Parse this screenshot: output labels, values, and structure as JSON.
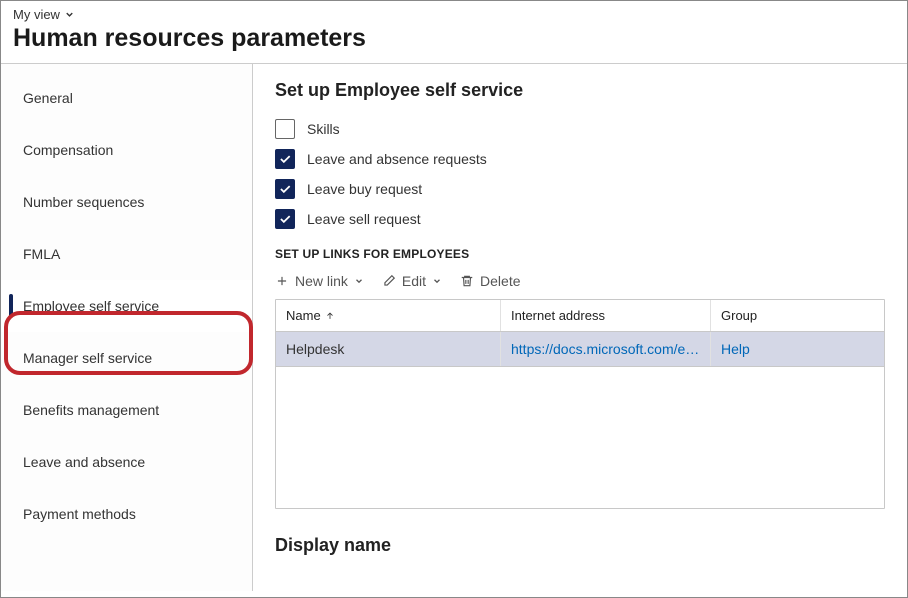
{
  "viewSelector": {
    "label": "My view"
  },
  "pageTitle": "Human resources parameters",
  "sidebar": {
    "items": [
      {
        "label": "General",
        "active": false
      },
      {
        "label": "Compensation",
        "active": false
      },
      {
        "label": "Number sequences",
        "active": false
      },
      {
        "label": "FMLA",
        "active": false
      },
      {
        "label": "Employee self service",
        "active": true
      },
      {
        "label": "Manager self service",
        "active": false
      },
      {
        "label": "Benefits management",
        "active": false
      },
      {
        "label": "Leave and absence",
        "active": false
      },
      {
        "label": "Payment methods",
        "active": false
      }
    ]
  },
  "content": {
    "sectionTitle": "Set up Employee self service",
    "checkboxes": [
      {
        "label": "Skills",
        "checked": false
      },
      {
        "label": "Leave and absence requests",
        "checked": true
      },
      {
        "label": "Leave buy request",
        "checked": true
      },
      {
        "label": "Leave sell request",
        "checked": true
      }
    ],
    "linksCaption": "SET UP LINKS FOR EMPLOYEES",
    "toolbar": {
      "newLink": "New link",
      "edit": "Edit",
      "delete": "Delete"
    },
    "table": {
      "columns": {
        "name": "Name",
        "addr": "Internet address",
        "group": "Group"
      },
      "sortAsc": true,
      "rows": [
        {
          "name": "Helpdesk",
          "addr": "https://docs.microsoft.com/en-u...",
          "group": "Help"
        }
      ]
    },
    "displaySectionTitle": "Display name"
  }
}
